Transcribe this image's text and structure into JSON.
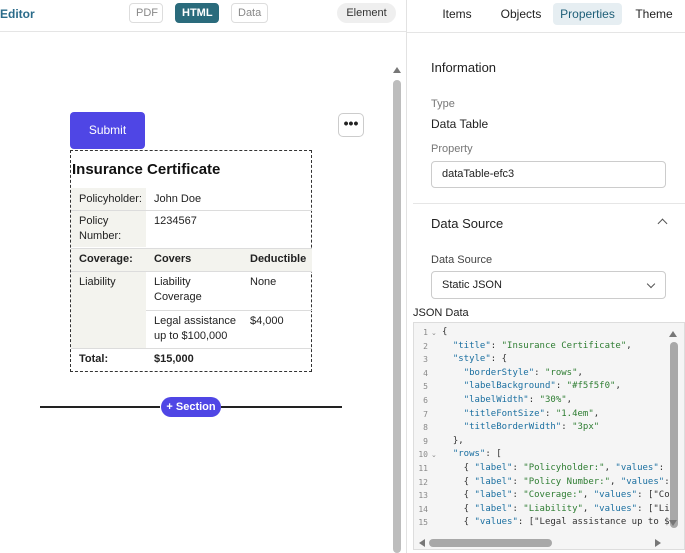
{
  "topbar": {
    "editor_label": "Editor",
    "pdf": "PDF",
    "html": "HTML",
    "data": "Data",
    "element": "Element"
  },
  "canvas": {
    "submit": "Submit",
    "more": "•••",
    "section_button": "+ Section",
    "certificate": {
      "title": "Insurance Certificate",
      "policyholder_label": "Policyholder:",
      "policyholder_value": "John Doe",
      "policy_number_label": "Policy Number:",
      "policy_number_value": "1234567",
      "coverage_label": "Coverage:",
      "covers_header": "Covers",
      "deductible_header": "Deductible",
      "liability_label": "Liability",
      "liability_cover": "Liability Coverage",
      "liability_deductible": "None",
      "legal_cover": "Legal assistance up to $100,000",
      "legal_deductible": "$4,000",
      "total_label": "Total:",
      "total_value": "$15,000"
    }
  },
  "tabs": {
    "items": "Items",
    "objects": "Objects",
    "properties": "Properties",
    "theme": "Theme"
  },
  "properties": {
    "information_header": "Information",
    "type_label": "Type",
    "type_value": "Data Table",
    "property_label": "Property",
    "property_value": "dataTable-efc3",
    "datasource_header": "Data Source",
    "datasource_label": "Data Source",
    "datasource_value": "Static JSON",
    "json_label": "JSON Data"
  },
  "json_lines": [
    "{",
    "  \"title\": \"Insurance Certificate\",",
    "  \"style\": {",
    "    \"borderStyle\": \"rows\",",
    "    \"labelBackground\": \"#f5f5f0\",",
    "    \"labelWidth\": \"30%\",",
    "    \"titleFontSize\": \"1.4em\",",
    "    \"titleBorderWidth\": \"3px\"",
    "  },",
    "  \"rows\": [",
    "    { \"label\": \"Policyholder:\", \"values\":",
    "    { \"label\": \"Policy Number:\", \"values\":",
    "    { \"label\": \"Coverage:\", \"values\": [\"Co",
    "    { \"label\": \"Liability\", \"values\": [\"Li",
    "    { \"values\": [\"Legal assistance up to $"
  ],
  "colors": {
    "accent": "#4f46e5",
    "html_tab": "#2a6b7c",
    "label_background": "#f5f5f0"
  }
}
